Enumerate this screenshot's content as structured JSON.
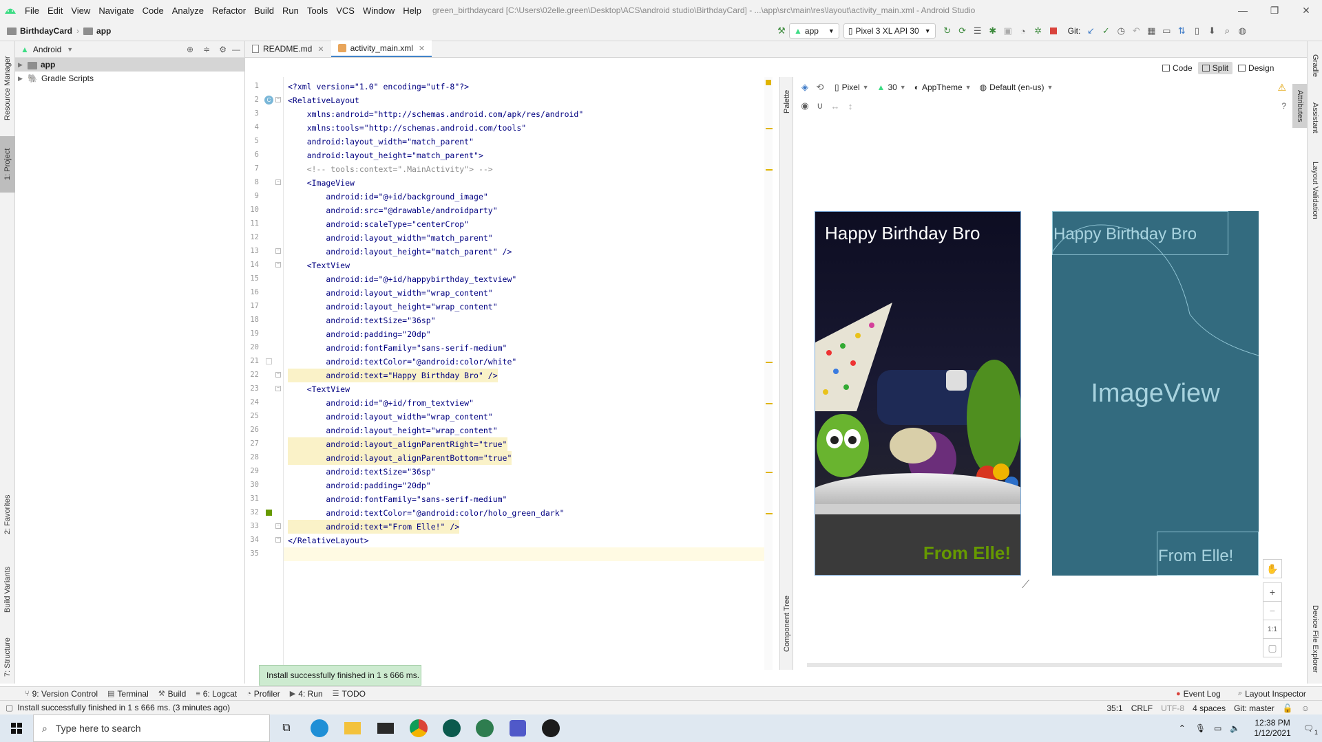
{
  "window": {
    "title": "green_birthdaycard [C:\\Users\\02elle.green\\Desktop\\ACS\\android studio\\BirthdayCard] - ...\\app\\src\\main\\res\\layout\\activity_main.xml - Android Studio",
    "minimize": "—",
    "maximize": "❐",
    "close": "✕"
  },
  "menu": [
    "File",
    "Edit",
    "View",
    "Navigate",
    "Code",
    "Analyze",
    "Refactor",
    "Build",
    "Run",
    "Tools",
    "VCS",
    "Window",
    "Help"
  ],
  "breadcrumb": {
    "project": "BirthdayCard",
    "module": "app"
  },
  "toolbar": {
    "run_config": "app",
    "device": "Pixel 3 XL API 30",
    "git_label": "Git:"
  },
  "left_strip": {
    "resource_manager": "Resource Manager",
    "project": "1: Project",
    "favorites": "2: Favorites",
    "build_variants": "Build Variants",
    "structure": "7: Structure"
  },
  "right_strip": {
    "gradle": "Gradle",
    "assistant": "Assistant",
    "attributes": "Attributes",
    "layout_validation": "Layout Validation",
    "device_file_explorer": "Device File Explorer"
  },
  "project_panel": {
    "view_selector": "Android",
    "tree": [
      {
        "label": "app",
        "selected": true
      },
      {
        "label": "Gradle Scripts",
        "selected": false
      }
    ]
  },
  "editor": {
    "tabs": [
      {
        "label": "README.md",
        "active": false
      },
      {
        "label": "activity_main.xml",
        "active": true
      }
    ],
    "view_modes": [
      "Code",
      "Split",
      "Design"
    ],
    "active_view_mode": "Split",
    "lines": [
      "<?xml version=\"1.0\" encoding=\"utf-8\"?>",
      "<RelativeLayout",
      "    xmlns:android=\"http://schemas.android.com/apk/res/android\"",
      "    xmlns:tools=\"http://schemas.android.com/tools\"",
      "    android:layout_width=\"match_parent\"",
      "    android:layout_height=\"match_parent\">",
      "    <!-- tools:context=\".MainActivity\"> -->",
      "    <ImageView",
      "        android:id=\"@+id/background_image\"",
      "        android:src=\"@drawable/androidparty\"",
      "        android:scaleType=\"centerCrop\"",
      "        android:layout_width=\"match_parent\"",
      "        android:layout_height=\"match_parent\" />",
      "    <TextView",
      "        android:id=\"@+id/happybirthday_textview\"",
      "        android:layout_width=\"wrap_content\"",
      "        android:layout_height=\"wrap_content\"",
      "        android:textSize=\"36sp\"",
      "        android:padding=\"20dp\"",
      "        android:fontFamily=\"sans-serif-medium\"",
      "        android:textColor=\"@android:color/white\"",
      "        android:text=\"Happy Birthday Bro\" />",
      "    <TextView",
      "        android:id=\"@+id/from_textview\"",
      "        android:layout_width=\"wrap_content\"",
      "        android:layout_height=\"wrap_content\"",
      "        android:layout_alignParentRight=\"true\"",
      "        android:layout_alignParentBottom=\"true\"",
      "        android:textSize=\"36sp\"",
      "        android:padding=\"20dp\"",
      "        android:fontFamily=\"sans-serif-medium\"",
      "        android:textColor=\"@android:color/holo_green_dark\"",
      "        android:text=\"From Elle!\" />",
      "</RelativeLayout>",
      ""
    ],
    "line_numbers": [
      "1",
      "2",
      "3",
      "4",
      "5",
      "6",
      "7",
      "8",
      "9",
      "10",
      "11",
      "12",
      "13",
      "14",
      "15",
      "16",
      "17",
      "18",
      "19",
      "20",
      "21",
      "22",
      "23",
      "24",
      "25",
      "26",
      "27",
      "28",
      "29",
      "30",
      "31",
      "32",
      "33",
      "34",
      "35"
    ]
  },
  "side_panels": {
    "palette": "Palette",
    "component_tree": "Component Tree"
  },
  "design": {
    "device": "Pixel",
    "api": "30",
    "theme": "AppTheme",
    "locale": "Default (en-us)",
    "preview": {
      "title_text": "Happy Birthday Bro",
      "from_text": "From Elle!",
      "title_color": "#ffffff",
      "from_color": "#669900"
    },
    "blueprint": {
      "title_text": "Happy Birthday Bro",
      "image_label": "ImageView",
      "from_text": "From Elle!"
    },
    "zoom": {
      "zoom_in": "+",
      "zoom_out": "−",
      "one_to_one": "1:1"
    }
  },
  "toast": {
    "text": "Install successfully finished in 1 s 666 ms."
  },
  "bottom_tools": [
    {
      "label": "9: Version Control",
      "icon": "version-control-icon"
    },
    {
      "label": "Terminal",
      "icon": "terminal-icon"
    },
    {
      "label": "Build",
      "icon": "build-icon"
    },
    {
      "label": "6: Logcat",
      "icon": "logcat-icon"
    },
    {
      "label": "Profiler",
      "icon": "profiler-icon"
    },
    {
      "label": "4: Run",
      "icon": "run-icon"
    },
    {
      "label": "TODO",
      "icon": "todo-icon"
    }
  ],
  "bottom_tools_right": {
    "event_log": "Event Log",
    "layout_inspector": "Layout Inspector"
  },
  "status": {
    "message": "Install successfully finished in 1 s 666 ms. (3 minutes ago)",
    "position": "35:1",
    "line_sep": "CRLF",
    "encoding": "UTF-8",
    "indent": "4 spaces",
    "git_branch": "Git: master"
  },
  "taskbar": {
    "search_placeholder": "Type here to search",
    "time": "12:38 PM",
    "date": "1/12/2021",
    "notification_count": "1"
  },
  "colors": {
    "accent": "#4083c9",
    "blueprint_bg": "#336b7f",
    "toast_bg": "#cdebd0",
    "android_green": "#3ddc84"
  }
}
